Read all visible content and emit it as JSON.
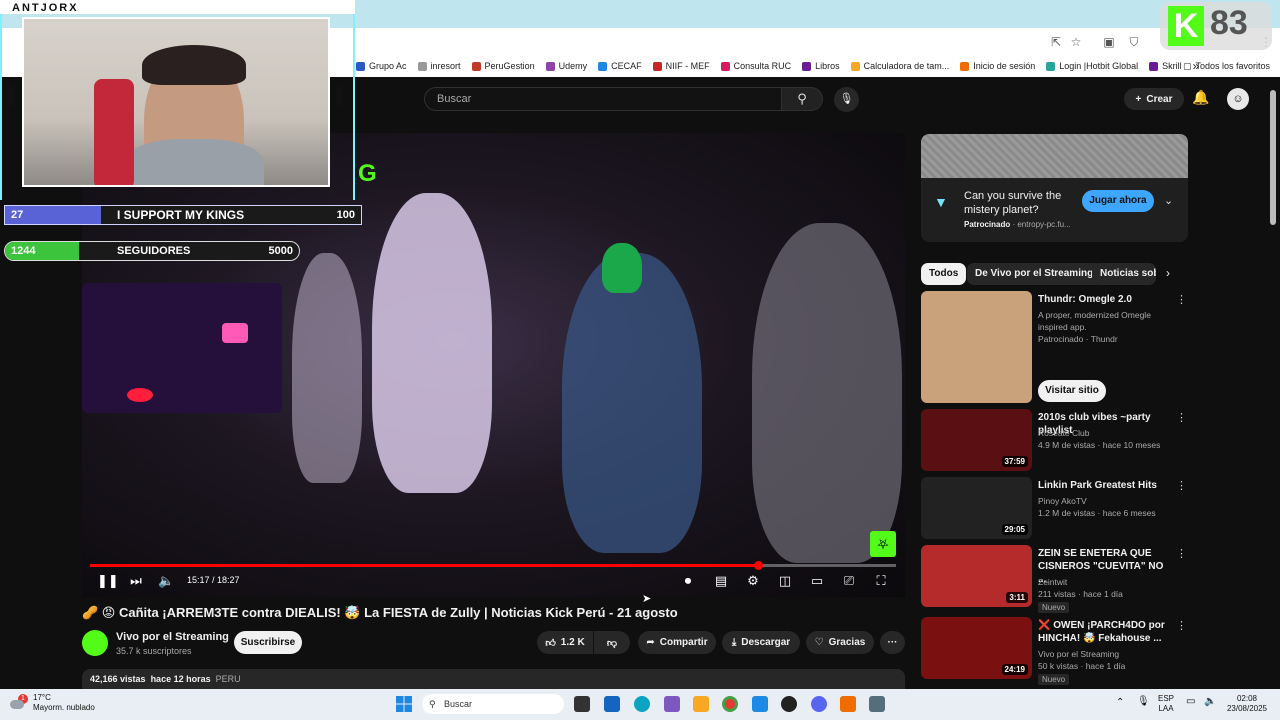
{
  "browser": {
    "bookmarks": [
      {
        "label": "Grupo Ac",
        "color": "#2b59c3"
      },
      {
        "label": "inresort",
        "color": "#999999"
      },
      {
        "label": "PeruGestion",
        "color": "#c0392b"
      },
      {
        "label": "Udemy",
        "color": "#8e44ad"
      },
      {
        "label": "CECAF",
        "color": "#1e88e5"
      },
      {
        "label": "NIIF - MEF",
        "color": "#c62828"
      },
      {
        "label": "Consulta RUC",
        "color": "#d81b60"
      },
      {
        "label": "Libros",
        "color": "#6a1b9a"
      },
      {
        "label": "Calculadora de tam...",
        "color": "#f9a825"
      },
      {
        "label": "Inicio de sesión",
        "color": "#ef6c00"
      },
      {
        "label": "Login |Hotbit Global",
        "color": "#26a69a"
      },
      {
        "label": "Skrill",
        "color": "#6a1b9a"
      }
    ],
    "bookmarks_more": "»",
    "all_favorites": "Todos los favoritos"
  },
  "youtube": {
    "search_placeholder": "Buscar",
    "create_label": "Crear"
  },
  "overlay": {
    "brand": "ANTJORX",
    "goal1": {
      "current": "27",
      "label": "I SUPPORT MY KINGS",
      "target": "100",
      "progress": 0.27
    },
    "goal2": {
      "current": "1244",
      "label": "SEGUIDORES",
      "target": "5000",
      "progress": 0.25
    },
    "kick_letter": "K",
    "kick_count": "83"
  },
  "player": {
    "time": "15:17 / 18:27",
    "progress": 0.829
  },
  "video": {
    "title": "🥜 😡 Cañita ¡ARREM3TE contra DIEALIS! 🤯 La FIESTA de Zully | Noticias Kick Perú - 21 agosto",
    "channel": "Vivo por el Streaming",
    "subscribers": "35.7 k suscriptores",
    "subscribe_label": "Suscribirse",
    "likes": "1.2 K",
    "share_label": "Compartir",
    "download_label": "Descargar",
    "thanks_label": "Gracias",
    "more_label": "···",
    "views": "42,166 vistas",
    "posted": "hace 12 horas",
    "tag": "PERU"
  },
  "ad": {
    "title": "Can you survive the mistery planet?",
    "sponsored": "Patrocinado",
    "domain": "· entropy-pc.fu...",
    "cta": "Jugar ahora"
  },
  "chips": [
    "Todos",
    "De Vivo por el Streaming",
    "Noticias sob"
  ],
  "recommendations": [
    {
      "title": "Thundr: Omegle 2.0",
      "line1": "A proper, modernized Omegle",
      "line2": "inspired app.",
      "line3": "Patrocinado · Thundr",
      "duration": "",
      "badge": "",
      "cta": "Visitar sitio"
    },
    {
      "title": "2010s club vibes ~party playlist",
      "line1": "Roseate Club",
      "line2": "4.9 M de vistas · hace 10 meses",
      "line3": "",
      "duration": "37:59",
      "badge": ""
    },
    {
      "title": "Linkin Park Greatest Hits",
      "line1": "Pinoy AkoTV",
      "line2": "1.2 M de vistas · hace 6 meses",
      "line3": "",
      "duration": "29:05",
      "badge": ""
    },
    {
      "title": "ZEIN SE ENETERA QUE CISNEROS \"CUEVITA\" NO ...",
      "line1": "Zeintwit",
      "line2": "211 vistas · hace 1 día",
      "line3": "",
      "duration": "3:11",
      "badge": "Nuevo"
    },
    {
      "title": "❌ OWEN ¡PARCH4DO por HINCHA! 🤯 Fekahouse ...",
      "line1": "Vivo por el Streaming",
      "line2": "50 k vistas · hace 1 día",
      "line3": "",
      "duration": "24:19",
      "badge": "Nuevo"
    }
  ],
  "taskbar": {
    "temp": "17°C",
    "weather": "Mayorm. nublado",
    "search": "Buscar",
    "lang1": "ESP",
    "lang2": "LAA",
    "time": "02:08",
    "date": "23/08/2025",
    "notif": "1"
  }
}
